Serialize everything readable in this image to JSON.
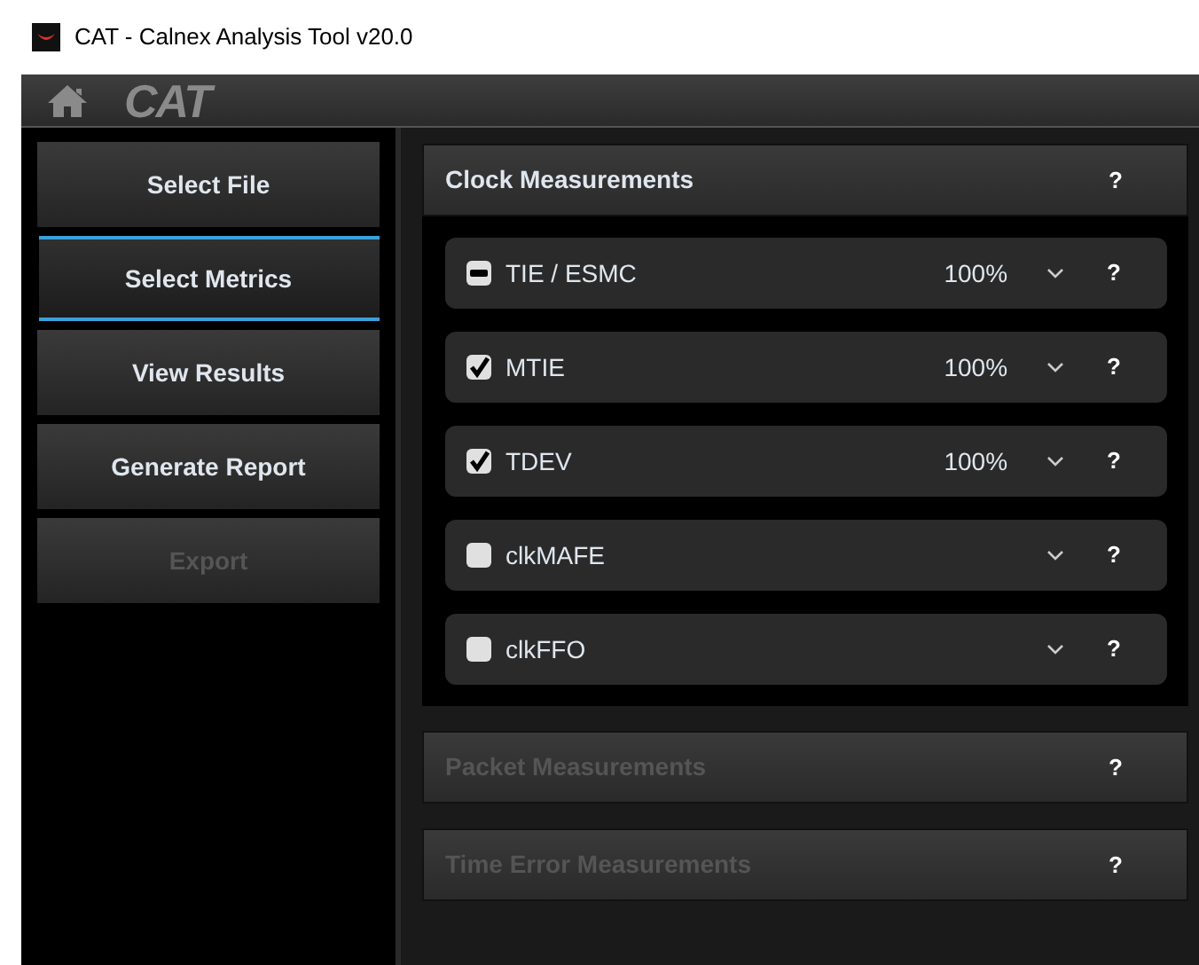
{
  "window": {
    "title": "CAT - Calnex Analysis Tool v20.0"
  },
  "header": {
    "logo": "CAT"
  },
  "nav": [
    {
      "label": "Select File",
      "selected": false,
      "disabled": false
    },
    {
      "label": "Select Metrics",
      "selected": true,
      "disabled": false
    },
    {
      "label": "View Results",
      "selected": false,
      "disabled": false
    },
    {
      "label": "Generate Report",
      "selected": false,
      "disabled": false
    },
    {
      "label": "Export",
      "selected": false,
      "disabled": true
    }
  ],
  "sections": [
    {
      "title": "Clock Measurements",
      "help": "?",
      "disabled": false,
      "expanded": true,
      "metrics": [
        {
          "name": "TIE / ESMC",
          "checked": false,
          "indeterminate": true,
          "percent": "100%",
          "help": "?"
        },
        {
          "name": "MTIE",
          "checked": true,
          "indeterminate": false,
          "percent": "100%",
          "help": "?"
        },
        {
          "name": "TDEV",
          "checked": true,
          "indeterminate": false,
          "percent": "100%",
          "help": "?"
        },
        {
          "name": "clkMAFE",
          "checked": false,
          "indeterminate": false,
          "help": "?"
        },
        {
          "name": "clkFFO",
          "checked": false,
          "indeterminate": false,
          "help": "?"
        }
      ]
    },
    {
      "title": "Packet Measurements",
      "help": "?",
      "disabled": true,
      "expanded": false
    },
    {
      "title": "Time Error Measurements",
      "help": "?",
      "disabled": true,
      "expanded": false
    }
  ]
}
